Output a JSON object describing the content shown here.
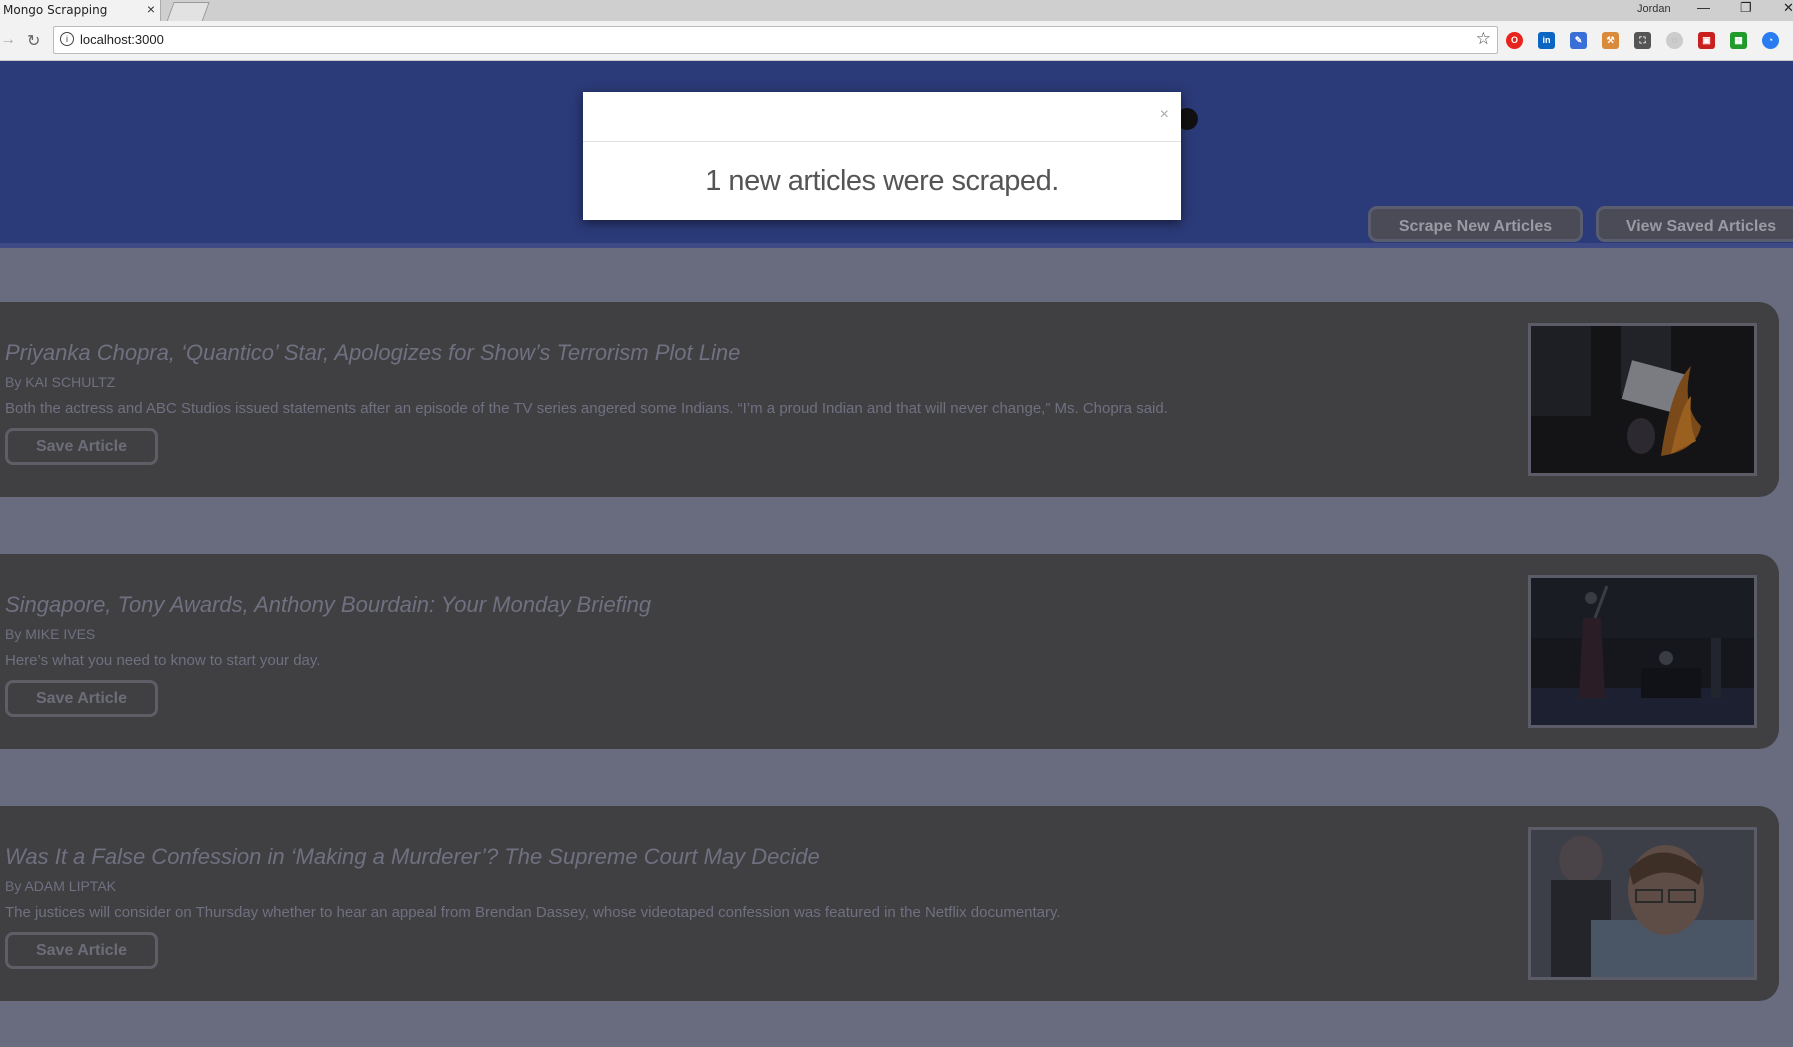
{
  "browser": {
    "tab_title": "Mongo Scrapping",
    "tab_close": "×",
    "profile": "Jordan",
    "url": "localhost:3000",
    "window_controls": {
      "minimize": "—",
      "restore": "❐",
      "close": "✕"
    }
  },
  "header": {
    "scrape_button": "Scrape New Articles",
    "saved_button": "View Saved Articles"
  },
  "articles": [
    {
      "title": "Priyanka Chopra, ‘Quantico’ Star, Apologizes for Show’s Terrorism Plot Line",
      "byline": "By KAI SCHULTZ",
      "summary": "Both the actress and ABC Studios issued statements after an episode of the TV series angered some Indians. “I’m a proud Indian and that will never change,” Ms. Chopra said.",
      "save_label": "Save Article"
    },
    {
      "title": "Singapore, Tony Awards, Anthony Bourdain: Your Monday Briefing",
      "byline": "By MIKE IVES",
      "summary": "Here’s what you need to know to start your day.",
      "save_label": "Save Article"
    },
    {
      "title": "Was It a False Confession in ‘Making a Murderer’? The Supreme Court May Decide",
      "byline": "By ADAM LIPTAK",
      "summary": "The justices will consider on Thursday whether to hear an appeal from Brendan Dassey, whose videotaped confession was featured in the Netflix documentary.",
      "save_label": "Save Article"
    }
  ],
  "modal": {
    "close": "×",
    "message": "1 new articles were scraped."
  },
  "colors": {
    "header_bg": "#2b3a78",
    "page_bg": "#696b7e",
    "card_bg": "#404043"
  }
}
